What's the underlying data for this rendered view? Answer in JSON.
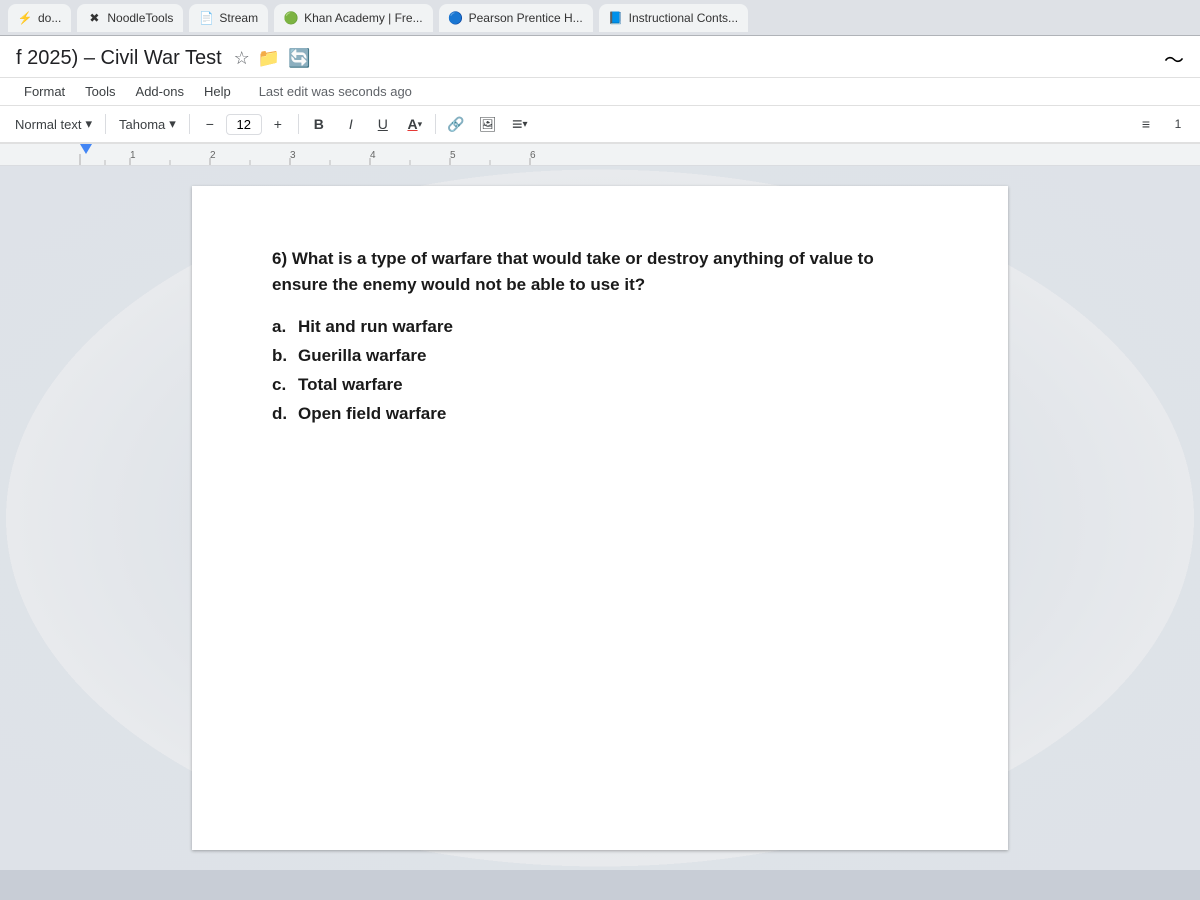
{
  "browser": {
    "tabs": [
      {
        "label": "do...",
        "icon": "⚡"
      },
      {
        "label": "NoodleTools",
        "icon": "📋"
      },
      {
        "label": "Stream",
        "icon": "📄"
      },
      {
        "label": "Khan Academy | Fre...",
        "icon": "🟢"
      },
      {
        "label": "Pearson Prentice H...",
        "icon": "🔵"
      },
      {
        "label": "Instructional Conts...",
        "icon": "📘"
      }
    ]
  },
  "docs": {
    "title": "f 2025) – Civil War Test",
    "menu_items": [
      "Format",
      "Tools",
      "Add-ons",
      "Help"
    ],
    "last_edit": "Last edit was seconds ago",
    "toolbar": {
      "normal_text_label": "Normal text",
      "font_label": "Tahoma",
      "font_size": "12",
      "bold": "B",
      "italic": "I",
      "underline": "U",
      "strikethrough": "A"
    },
    "ruler": {
      "marks": [
        "1",
        "2",
        "3",
        "4",
        "5",
        "6"
      ]
    },
    "question": {
      "number": "6)",
      "text": "What is a type of warfare that would take or destroy anything of value to ensure the enemy would not be able to use it?",
      "answers": [
        {
          "label": "a.",
          "text": "Hit and run warfare"
        },
        {
          "label": "b.",
          "text": "Guerilla warfare"
        },
        {
          "label": "c.",
          "text": "Total warfare"
        },
        {
          "label": "d.",
          "text": "Open field warfare"
        }
      ]
    }
  }
}
